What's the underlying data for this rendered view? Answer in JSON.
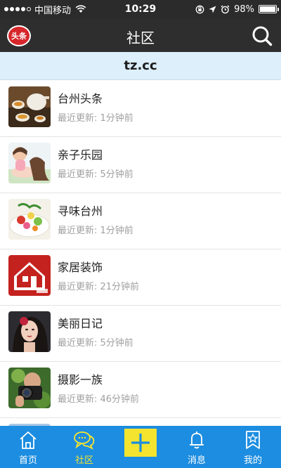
{
  "status_bar": {
    "carrier": "中国移动",
    "time": "10:29",
    "battery": "98%",
    "battery_level": 0.98
  },
  "nav": {
    "logo_text": "头条",
    "title": "社区"
  },
  "banner": {
    "domain": "tz.cc"
  },
  "list": [
    {
      "title": "台州头条",
      "subtitle": "最近更新: 1分钟前",
      "thumb": "tea-set-image"
    },
    {
      "title": "亲子乐园",
      "subtitle": "最近更新: 5分钟前",
      "thumb": "parent-child-image"
    },
    {
      "title": "寻味台州",
      "subtitle": "最近更新: 1分钟前",
      "thumb": "food-plate-image"
    },
    {
      "title": "家居装饰",
      "subtitle": "最近更新: 21分钟前",
      "thumb": "house-logo-image"
    },
    {
      "title": "美丽日记",
      "subtitle": "最近更新: 5分钟前",
      "thumb": "woman-portrait-image"
    },
    {
      "title": "摄影一族",
      "subtitle": "最近更新: 46分钟前",
      "thumb": "camera-photographer-image"
    }
  ],
  "tabs": [
    {
      "label": "首页",
      "icon": "home-icon"
    },
    {
      "label": "社区",
      "icon": "chat-bubbles-icon",
      "active": true
    },
    {
      "label": "",
      "icon": "plus-icon"
    },
    {
      "label": "消息",
      "icon": "bell-icon"
    },
    {
      "label": "我的",
      "icon": "bookmark-star-icon"
    }
  ],
  "colors": {
    "nav_bg": "#2e2e2e",
    "banner_bg": "#dceffb",
    "tab_bar_bg": "#1c8de0",
    "accent_yellow": "#f4e430"
  }
}
